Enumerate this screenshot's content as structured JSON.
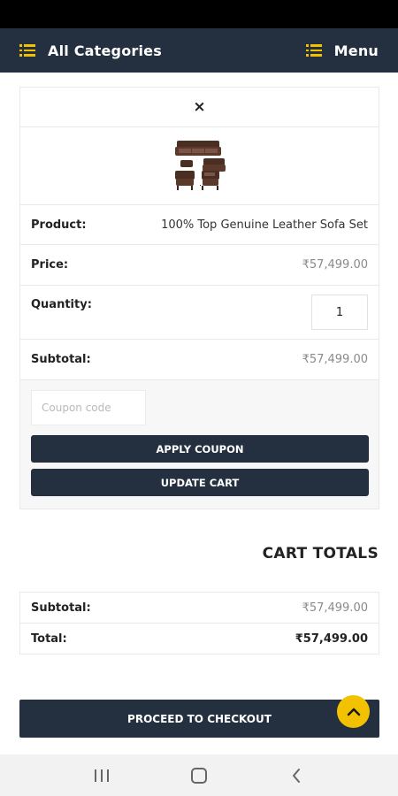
{
  "header": {
    "categories_label": "All Categories",
    "menu_label": "Menu",
    "categories_icon": "list-icon",
    "menu_icon": "list-icon"
  },
  "cart": {
    "remove_icon": "close-icon",
    "remove_symbol": "×",
    "product_image": "leather-sofa-set-thumbnail",
    "product_label": "Product:",
    "product_name": "100% Top Genuine Leather Sofa Set",
    "price_label": "Price:",
    "price_value": "₹57,499.00",
    "quantity_label": "Quantity:",
    "quantity_value": "1",
    "subtotal_label": "Subtotal:",
    "subtotal_value": "₹57,499.00",
    "coupon_placeholder": "Coupon code",
    "apply_coupon_label": "APPLY COUPON",
    "update_cart_label": "UPDATE CART"
  },
  "totals": {
    "heading": "CART TOTALS",
    "subtotal_label": "Subtotal:",
    "subtotal_value": "₹57,499.00",
    "total_label": "Total:",
    "total_value": "₹57,499.00"
  },
  "checkout": {
    "label": "PROCEED TO CHECKOUT",
    "scroll_top_icon": "chevron-up-icon"
  },
  "system_nav": {
    "recents_icon": "recents-icon",
    "home_icon": "home-icon",
    "back_icon": "back-icon"
  },
  "colors": {
    "nav_bg": "#243040",
    "accent": "#f2c200",
    "muted_text": "#8a8a8a"
  }
}
